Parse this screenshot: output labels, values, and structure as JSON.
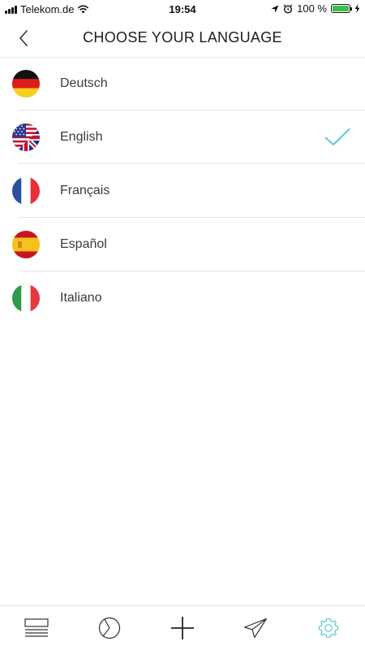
{
  "status_bar": {
    "carrier": "Telekom.de",
    "time": "19:54",
    "battery_percent": "100 %",
    "battery_level": 1.0
  },
  "header": {
    "title": "CHOOSE YOUR LANGUAGE",
    "back_icon": "chevron-left-icon"
  },
  "languages": [
    {
      "label": "Deutsch",
      "flag": "germany-flag-icon",
      "selected": false
    },
    {
      "label": "English",
      "flag": "usa-uk-flag-icon",
      "selected": true
    },
    {
      "label": "Français",
      "flag": "france-flag-icon",
      "selected": false
    },
    {
      "label": "Español",
      "flag": "spain-flag-icon",
      "selected": false
    },
    {
      "label": "Italiano",
      "flag": "italy-flag-icon",
      "selected": false
    }
  ],
  "tabbar": {
    "tabs": [
      {
        "icon": "list-icon",
        "active": false
      },
      {
        "icon": "pie-chart-icon",
        "active": false
      },
      {
        "icon": "plus-icon",
        "active": false
      },
      {
        "icon": "send-icon",
        "active": false
      },
      {
        "icon": "gear-icon",
        "active": true
      }
    ]
  },
  "colors": {
    "accent": "#5bc8d8",
    "divider": "#e6e6e6",
    "text": "#3a3a3a"
  }
}
